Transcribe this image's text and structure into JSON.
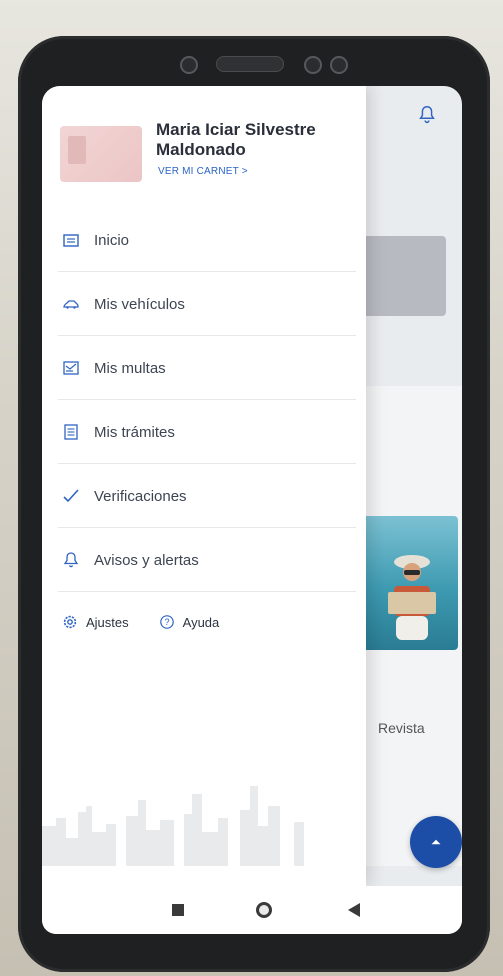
{
  "drawer": {
    "user_name": "Maria Iciar Silvestre Maldonado",
    "ver_carnet": "VER MI CARNET >",
    "menu": [
      {
        "label": "Inicio",
        "icon": "home-list-icon"
      },
      {
        "label": "Mis vehículos",
        "icon": "car-icon"
      },
      {
        "label": "Mis multas",
        "icon": "ticket-icon"
      },
      {
        "label": "Mis trámites",
        "icon": "document-icon"
      },
      {
        "label": "Verificaciones",
        "icon": "check-icon"
      },
      {
        "label": "Avisos y alertas",
        "icon": "bell-icon"
      }
    ],
    "bottom_links": [
      {
        "label": "Ajustes",
        "icon": "gear-icon"
      },
      {
        "label": "Ayuda",
        "icon": "help-icon"
      }
    ]
  },
  "background_app": {
    "revista_label": "Revista",
    "fab_icon": "chevron-up-icon",
    "top_icon": "bell-icon"
  },
  "navbar": {
    "buttons": [
      "recent-apps-icon",
      "home-icon",
      "back-icon"
    ]
  },
  "colors": {
    "accent": "#2a64c5",
    "fab": "#1c4ea7",
    "menu_text": "#3d4452",
    "icon_blue": "#2f64c2"
  }
}
